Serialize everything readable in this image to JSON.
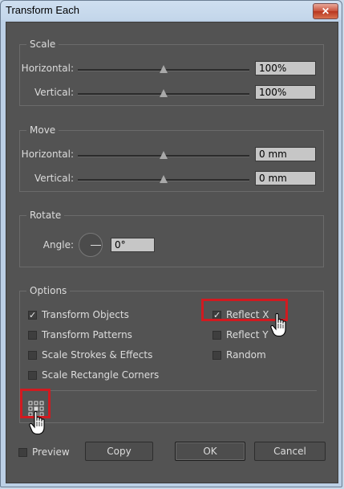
{
  "window": {
    "title": "Transform Each",
    "close_glyph": "✕"
  },
  "scale": {
    "legend": "Scale",
    "horizontal": {
      "label": "Horizontal:",
      "value": "100%",
      "level": 0.5
    },
    "vertical": {
      "label": "Vertical:",
      "value": "100%",
      "level": 0.5
    }
  },
  "move": {
    "legend": "Move",
    "horizontal": {
      "label": "Horizontal:",
      "value": "0 mm",
      "level": 0.5
    },
    "vertical": {
      "label": "Vertical:",
      "value": "0 mm",
      "level": 0.5
    }
  },
  "rotate": {
    "legend": "Rotate",
    "angle_label": "Angle:",
    "angle_value": "0°"
  },
  "options": {
    "legend": "Options",
    "transform_objects": {
      "label": "Transform Objects",
      "checked": true
    },
    "transform_patterns": {
      "label": "Transform Patterns",
      "checked": false
    },
    "scale_strokes": {
      "label": "Scale Strokes & Effects",
      "checked": false
    },
    "scale_corners": {
      "label": "Scale Rectangle Corners",
      "checked": false
    },
    "reflect_x": {
      "label": "Reflect X",
      "checked": true
    },
    "reflect_y": {
      "label": "Reflect Y",
      "checked": false
    },
    "random": {
      "label": "Random",
      "checked": false
    },
    "reference_point_icon": "reference-point-grid-icon"
  },
  "footer": {
    "preview_label": "Preview",
    "copy_label": "Copy",
    "ok_label": "OK",
    "cancel_label": "Cancel"
  },
  "check_glyph": "✓",
  "annotation_color": "#d11a20"
}
